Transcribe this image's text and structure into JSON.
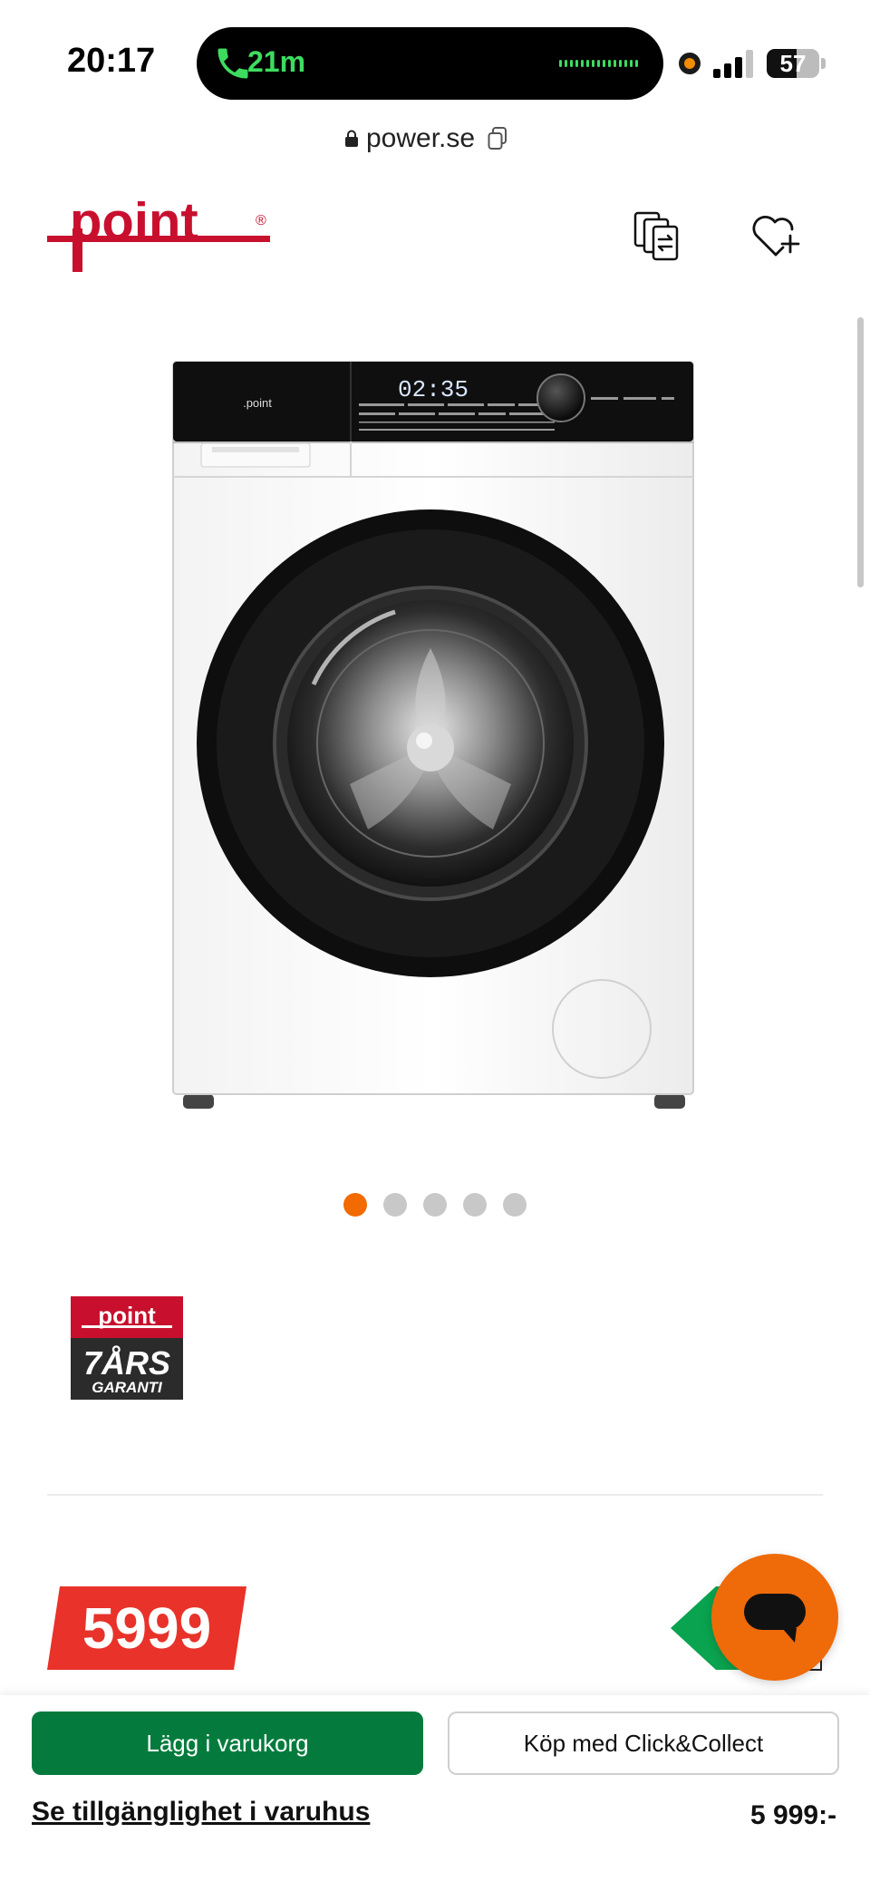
{
  "status_bar": {
    "time": "20:17",
    "call_duration": "21m",
    "battery_level": "57",
    "battery_fraction": 0.57
  },
  "browser": {
    "url": "power.se"
  },
  "header": {
    "logo_text": "point",
    "logo_mark": "®",
    "compare_icon": "compare-icon",
    "wishlist_icon": "heart-plus-icon"
  },
  "product": {
    "image_brand_text": ".point",
    "display_time": "02:35",
    "carousel": {
      "count": 5,
      "active_index": 0
    }
  },
  "warranty_badge": {
    "brand": "point",
    "years_text": "7ÅRS",
    "label": "GARANTI"
  },
  "price": {
    "amount": "5999",
    "formatted": "5 999:-"
  },
  "actions": {
    "add_to_cart": "Lägg i varukorg",
    "click_collect": "Köp med Click&Collect",
    "store_availability": "Se tillgänglighet i varuhus"
  },
  "colors": {
    "brand_red": "#c8102e",
    "price_red": "#e8322a",
    "cart_green": "#047b3d",
    "chat_orange": "#ef6a08",
    "dot_active": "#f26a00"
  }
}
